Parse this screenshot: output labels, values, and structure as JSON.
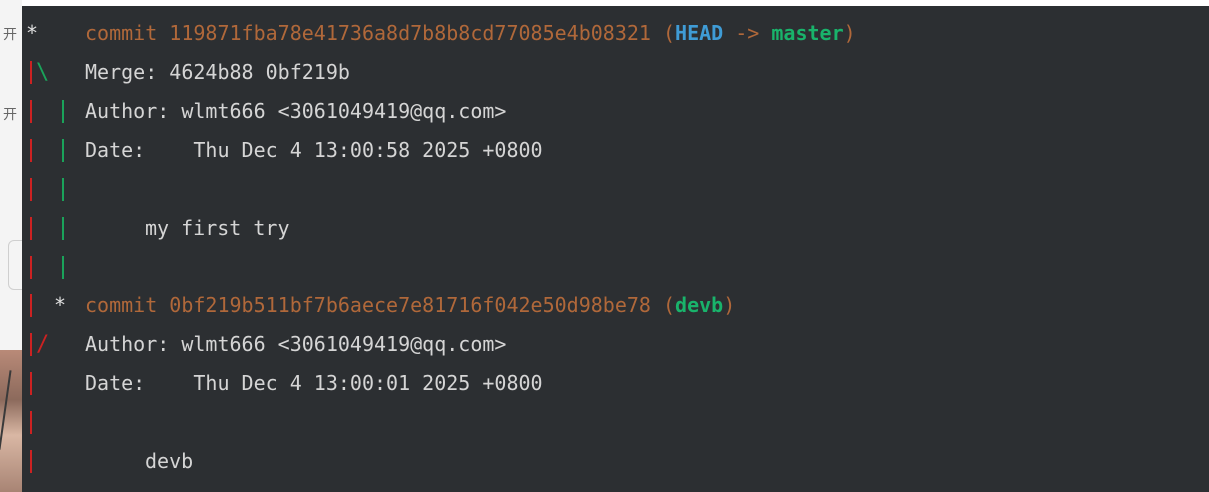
{
  "log": [
    {
      "type": "commit",
      "graph": "*",
      "commit_label": "commit",
      "hash": "119871fba78e41736a8d7b8b8cd77085e4b08321",
      "refs_open": "(",
      "head": "HEAD",
      "arrow": "->",
      "branch": "master",
      "refs_close": ")"
    },
    {
      "type": "merge",
      "graph": "|\\",
      "label": "Merge:",
      "value": "4624b88 0bf219b"
    },
    {
      "type": "author",
      "graph": "| |",
      "label": "Author:",
      "value": "wlmt666 <3061049419@qq.com>"
    },
    {
      "type": "date",
      "graph": "| |",
      "label": "Date:",
      "value": "Thu Dec 4 13:00:58 2025 +0800"
    },
    {
      "type": "blank",
      "graph": "| |"
    },
    {
      "type": "message",
      "graph": "| |",
      "value": "my first try"
    },
    {
      "type": "blank",
      "graph": "| |"
    },
    {
      "type": "commit",
      "graph": "| *",
      "commit_label": "commit",
      "hash": "0bf219b511bf7b6aece7e81716f042e50d98be78",
      "refs_open": "(",
      "branch": "devb",
      "refs_close": ")"
    },
    {
      "type": "author",
      "graph": "|/",
      "label": "Author:",
      "value": "wlmt666 <3061049419@qq.com>"
    },
    {
      "type": "date",
      "graph": "|",
      "label": "Date:",
      "value": "Thu Dec 4 13:00:01 2025 +0800"
    },
    {
      "type": "blank",
      "graph": "|"
    },
    {
      "type": "message",
      "graph": "|",
      "value": "devb"
    }
  ],
  "colors": {
    "background": "#2c2f32",
    "graph_red": "#cc2222",
    "graph_green": "#1aa35a",
    "commit": "#b0683a",
    "head": "#3f9cd6",
    "branch": "#19b36b",
    "text": "#d5d5d5"
  }
}
